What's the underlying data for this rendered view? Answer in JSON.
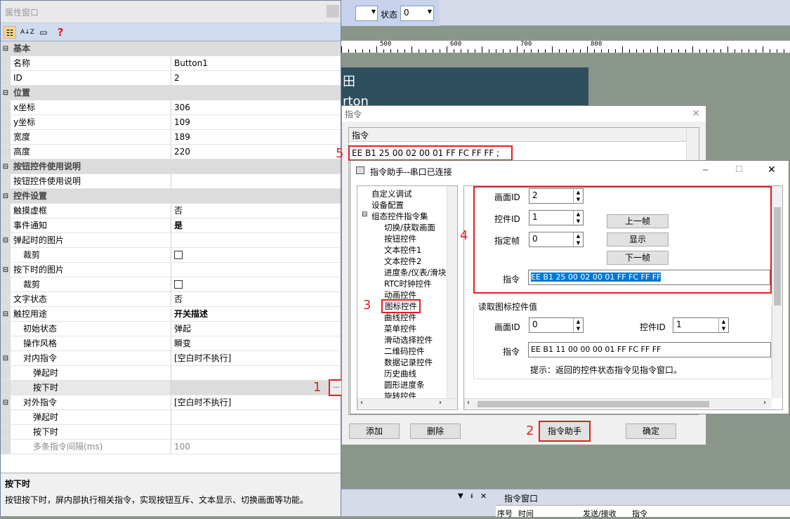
{
  "background": {
    "status_label": "状态",
    "status_value": "0",
    "ruler_labels": [
      "500",
      "600",
      "700",
      "800"
    ],
    "preview_text_top": "田",
    "preview_text_bottom": "rton"
  },
  "property_window": {
    "title": "属性窗口",
    "toolbar_icons": [
      "categorized-icon",
      "sort-az-icon",
      "page-icon",
      "help-icon"
    ],
    "help_glyph": "?",
    "sort_glyph": "A↓Z",
    "rows": [
      {
        "type": "cat",
        "toggle": "⊟",
        "name": "基本"
      },
      {
        "name": "名称",
        "value": "Button1"
      },
      {
        "name": "ID",
        "value": "2"
      },
      {
        "type": "cat",
        "toggle": "⊟",
        "name": "位置"
      },
      {
        "name": "x坐标",
        "value": "306"
      },
      {
        "name": "y坐标",
        "value": "109"
      },
      {
        "name": "宽度",
        "value": "189"
      },
      {
        "name": "高度",
        "value": "220"
      },
      {
        "type": "cat",
        "toggle": "⊟",
        "name": "按钮控件使用说明"
      },
      {
        "name": "按钮控件使用说明",
        "value": ""
      },
      {
        "type": "cat",
        "toggle": "⊟",
        "name": "控件设置"
      },
      {
        "name": "触摸虚框",
        "value": "否"
      },
      {
        "name": "事件通知",
        "value": "是",
        "bold": true
      },
      {
        "toggle": "⊟",
        "name": "弹起时的图片",
        "value": ""
      },
      {
        "name": "裁剪",
        "value": "",
        "check": true,
        "indent": 1
      },
      {
        "toggle": "⊟",
        "name": "按下时的图片",
        "value": ""
      },
      {
        "name": "裁剪",
        "value": "",
        "check": true,
        "indent": 1
      },
      {
        "name": "文字状态",
        "value": "否"
      },
      {
        "toggle": "⊟",
        "name": "触控用途",
        "value": "开关描述",
        "bold": true
      },
      {
        "name": "初始状态",
        "value": "弹起",
        "indent": 1
      },
      {
        "name": "操作风格",
        "value": "瞬变",
        "indent": 1
      },
      {
        "toggle": "⊟",
        "name": "对内指令",
        "value": "[空白时不执行]",
        "indent": 1
      },
      {
        "name": "弹起时",
        "value": "",
        "indent": 2
      },
      {
        "name": "按下时",
        "value": "",
        "indent": 2,
        "selected": true
      },
      {
        "toggle": "⊟",
        "name": "对外指令",
        "value": "[空白时不执行]",
        "indent": 1
      },
      {
        "name": "弹起时",
        "value": "",
        "indent": 2
      },
      {
        "name": "按下时",
        "value": "",
        "indent": 2
      },
      {
        "name": "多条指令间隔(ms)",
        "value": "100",
        "indent": 2,
        "dim": true
      }
    ],
    "help_title": "按下时",
    "help_text": "按钮按下时，屏内部执行相关指令，实现按钮互斥、文本显示、切换画面等功能。",
    "ellipsis_label": "..."
  },
  "command_window": {
    "title": "指令",
    "header": "指令",
    "row_text": "EE B1 25 00 02 00 01 FF FC FF FF ;",
    "add_label": "添加",
    "delete_label": "删除",
    "assistant_label": "指令助手",
    "ok_label": "确定"
  },
  "helper_dialog": {
    "title": "指令助手--串口已连接",
    "minimize": "─",
    "maximize": "☐",
    "close": "✕",
    "tree_items": [
      {
        "label": "自定义调试",
        "level": 1
      },
      {
        "label": "设备配置",
        "level": 1
      },
      {
        "label": "组态控件指令集",
        "level": 1,
        "toggle": "⊟"
      },
      {
        "label": "切换/获取画面",
        "level": 2
      },
      {
        "label": "按钮控件",
        "level": 2
      },
      {
        "label": "文本控件1",
        "level": 2
      },
      {
        "label": "文本控件2",
        "level": 2
      },
      {
        "label": "进度条/仪表/滑块",
        "level": 2
      },
      {
        "label": "RTC时钟控件",
        "level": 2
      },
      {
        "label": "动画控件",
        "level": 2
      },
      {
        "label": "图标控件",
        "level": 2,
        "boxed": true
      },
      {
        "label": "曲线控件",
        "level": 2
      },
      {
        "label": "菜单控件",
        "level": 2
      },
      {
        "label": "滑动选择控件",
        "level": 2
      },
      {
        "label": "二维码控件",
        "level": 2
      },
      {
        "label": "数据记录控件",
        "level": 2
      },
      {
        "label": "历史曲线",
        "level": 2
      },
      {
        "label": "圆形进度条",
        "level": 2
      },
      {
        "label": "旋转控件",
        "level": 2
      }
    ],
    "screen_id_label": "画面ID",
    "screen_id_value": "2",
    "control_id_label": "控件ID",
    "control_id_value": "1",
    "frame_label": "指定帧",
    "frame_value": "0",
    "prev_button": "上一帧",
    "show_button": "显示",
    "next_button": "下一帧",
    "cmd_label": "指令",
    "cmd_value": "EE B1 25 00 02 00 01 FF FC FF FF",
    "read_group_title": "读取图标控件值",
    "read_screen_id_label": "画面ID",
    "read_screen_id_value": "0",
    "read_control_id_label": "控件ID",
    "read_control_id_value": "1",
    "read_cmd_label": "指令",
    "read_cmd_value": "EE B1 11 00 00 00 01 FF FC FF FF",
    "hint": "提示：返回的控件状态指令见指令窗口。",
    "spin_up": "▲",
    "spin_down": "▼"
  },
  "bottom_panel": {
    "title": "指令窗口",
    "col_time": "时间",
    "col_dir": "发送/接收",
    "col_cmd": "指令",
    "col_seq": "序号"
  },
  "markers": [
    "1",
    "2",
    "3",
    "4",
    "5"
  ],
  "colors": {
    "highlight": "#e02020",
    "selection": "#0078d7",
    "panel_blue": "#cfdcf0"
  }
}
